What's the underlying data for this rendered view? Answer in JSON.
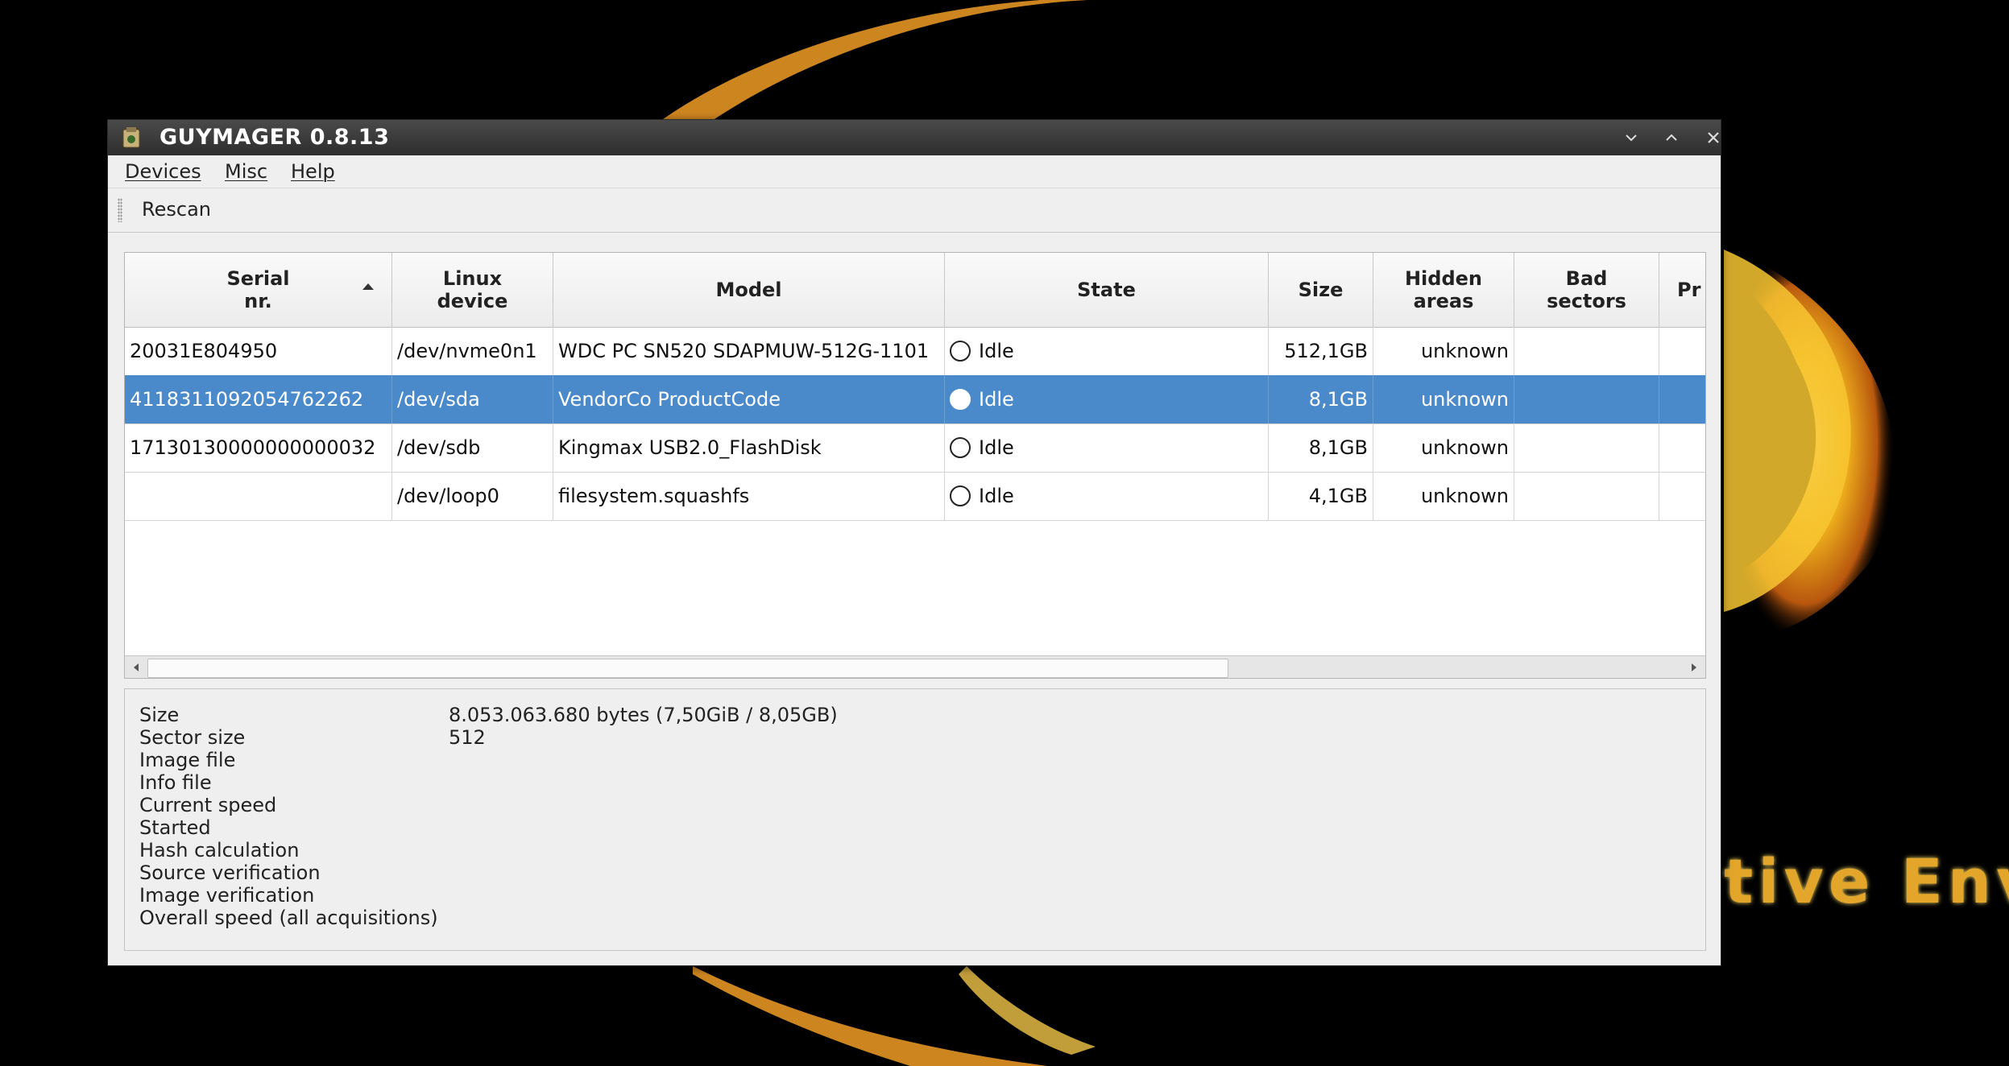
{
  "desktop": {
    "wallpaper_text": "tive Envi"
  },
  "window": {
    "title": "GUYMAGER 0.8.13",
    "icon": "guymager-app-icon",
    "controls": {
      "minimize": "chevron-down-icon",
      "maximize": "chevron-up-icon",
      "close": "close-icon"
    }
  },
  "menu": {
    "items": [
      {
        "label": "Devices"
      },
      {
        "label": "Misc"
      },
      {
        "label": "Help"
      }
    ]
  },
  "toolbar": {
    "rescan_label": "Rescan"
  },
  "table": {
    "columns": [
      {
        "label": "Serial\nnr.",
        "sorted": "ascending"
      },
      {
        "label": "Linux\ndevice"
      },
      {
        "label": "Model"
      },
      {
        "label": "State"
      },
      {
        "label": "Size"
      },
      {
        "label": "Hidden\nareas"
      },
      {
        "label": "Bad\nsectors"
      },
      {
        "label": "Pr"
      }
    ],
    "rows": [
      {
        "serial": "20031E804950",
        "device": "/dev/nvme0n1",
        "model": "WDC PC SN520 SDAPMUW-512G-1101",
        "state": "Idle",
        "size": "512,1GB",
        "hidden": "unknown",
        "bad": "",
        "selected": false
      },
      {
        "serial": "4118311092054762262",
        "device": "/dev/sda",
        "model": "VendorCo ProductCode",
        "state": "Idle",
        "size": "8,1GB",
        "hidden": "unknown",
        "bad": "",
        "selected": true
      },
      {
        "serial": "17130130000000000032",
        "device": "/dev/sdb",
        "model": "Kingmax USB2.0_FlashDisk",
        "state": "Idle",
        "size": "8,1GB",
        "hidden": "unknown",
        "bad": "",
        "selected": false
      },
      {
        "serial": "",
        "device": "/dev/loop0",
        "model": "filesystem.squashfs",
        "state": "Idle",
        "size": "4,1GB",
        "hidden": "unknown",
        "bad": "",
        "selected": false
      }
    ]
  },
  "info": {
    "rows": [
      {
        "label": "Size",
        "value": "8.053.063.680 bytes (7,50GiB / 8,05GB)"
      },
      {
        "label": "Sector size",
        "value": "512"
      },
      {
        "label": "Image file",
        "value": ""
      },
      {
        "label": "Info file",
        "value": ""
      },
      {
        "label": "Current speed",
        "value": ""
      },
      {
        "label": "Started",
        "value": ""
      },
      {
        "label": "Hash calculation",
        "value": ""
      },
      {
        "label": "Source verification",
        "value": ""
      },
      {
        "label": "Image verification",
        "value": ""
      },
      {
        "label": "Overall speed (all acquisitions)",
        "value": ""
      }
    ]
  },
  "colors": {
    "selection": "#4a8acb",
    "titlebar": "#2d2d2d",
    "window_bg": "#efefef"
  }
}
